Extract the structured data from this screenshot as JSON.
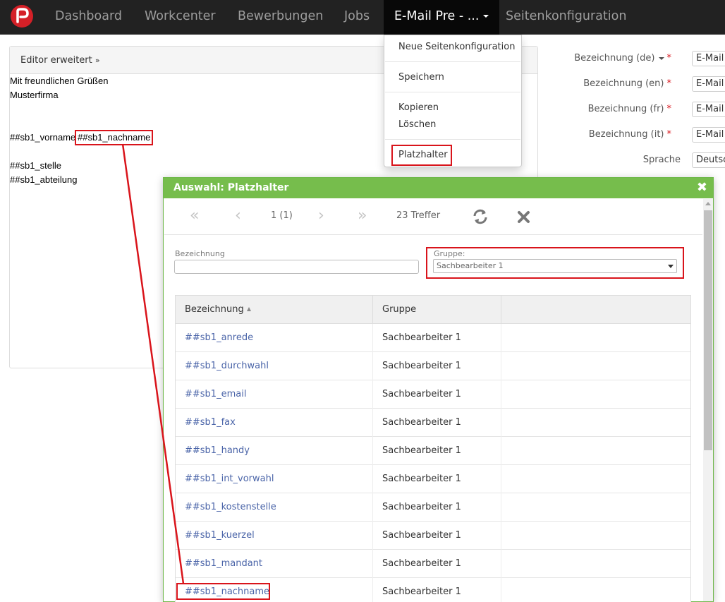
{
  "nav": {
    "items": [
      "Dashboard",
      "Workcenter",
      "Bewerbungen",
      "Jobs"
    ],
    "active": "E-Mail Pre - ...",
    "last": "Seitenkonfiguration"
  },
  "editor": {
    "toggle_label": "Editor erweitert",
    "lines": [
      "Mit freundlichen Grüßen",
      "Musterfirma",
      "##sb1_vorname",
      "##sb1_stelle",
      "##sb1_abteilung"
    ],
    "highlighted_placeholder": "##sb1_nachname"
  },
  "form": {
    "labels": [
      "Bezeichnung (de)",
      "Bezeichnung (en)",
      "Bezeichnung (fr)",
      "Bezeichnung (it)",
      "Sprache"
    ],
    "values": [
      "E-Mail",
      "E-Mail",
      "E-Mail",
      "E-Mail",
      "Deutsc"
    ],
    "required_mark": "*"
  },
  "dropdown": {
    "items": [
      "Neue Seitenkonfiguration",
      "Speichern",
      "Kopieren",
      "Löschen",
      "Platzhalter"
    ]
  },
  "modal": {
    "title": "Auswahl: Platzhalter",
    "close": "✖",
    "pager": {
      "page": "1 (1)",
      "hits": "23 Treffer"
    },
    "filter": {
      "bezeichnung_label": "Bezeichnung",
      "bezeichnung_value": "",
      "gruppe_label": "Gruppe:",
      "gruppe_value": "Sachbearbeiter 1"
    },
    "table": {
      "headers": [
        "Bezeichnung",
        "Gruppe"
      ],
      "rows": [
        {
          "name": "##sb1_anrede",
          "group": "Sachbearbeiter 1"
        },
        {
          "name": "##sb1_durchwahl",
          "group": "Sachbearbeiter 1"
        },
        {
          "name": "##sb1_email",
          "group": "Sachbearbeiter 1"
        },
        {
          "name": "##sb1_fax",
          "group": "Sachbearbeiter 1"
        },
        {
          "name": "##sb1_handy",
          "group": "Sachbearbeiter 1"
        },
        {
          "name": "##sb1_int_vorwahl",
          "group": "Sachbearbeiter 1"
        },
        {
          "name": "##sb1_kostenstelle",
          "group": "Sachbearbeiter 1"
        },
        {
          "name": "##sb1_kuerzel",
          "group": "Sachbearbeiter 1"
        },
        {
          "name": "##sb1_mandant",
          "group": "Sachbearbeiter 1"
        },
        {
          "name": "##sb1_nachname",
          "group": "Sachbearbeiter 1"
        }
      ]
    }
  },
  "colors": {
    "nav_bg": "#222222",
    "modal_header": "#76bd4c",
    "highlight": "#d9141b",
    "link": "#4a64a8"
  }
}
